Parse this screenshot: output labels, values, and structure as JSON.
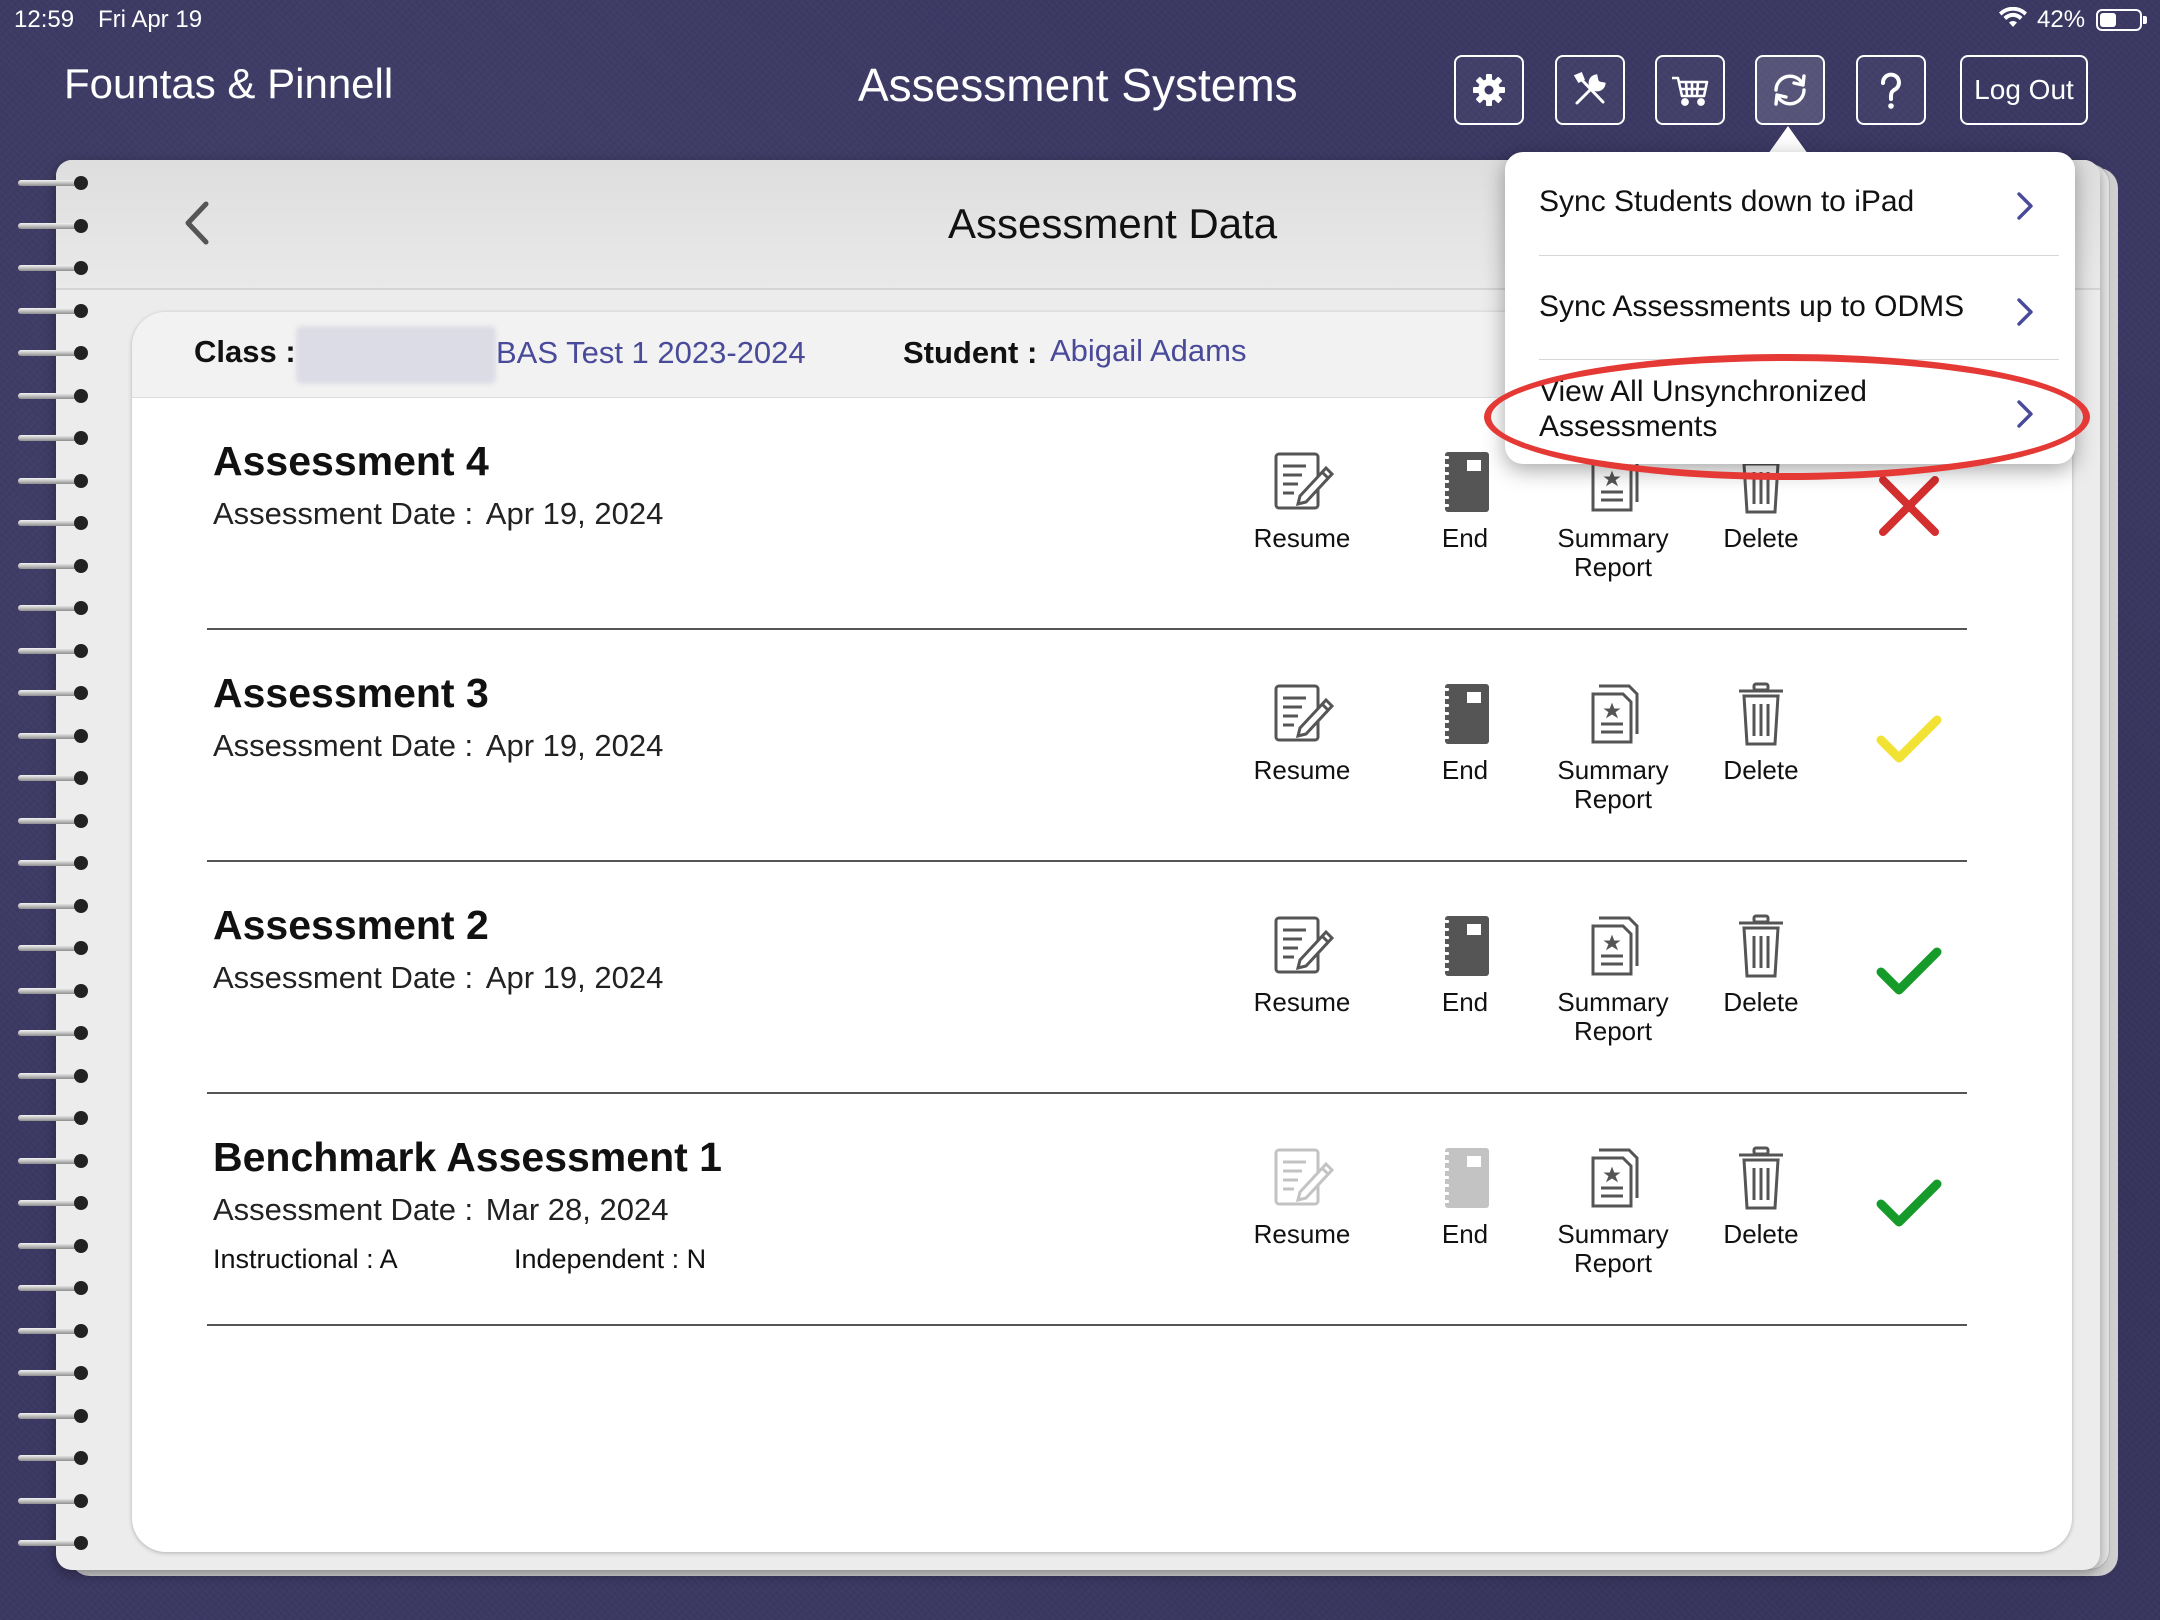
{
  "status_bar": {
    "time": "12:59",
    "date": "Fri Apr 19",
    "battery": "42%"
  },
  "header": {
    "brand": "Fountas & Pinnell",
    "title": "Assessment Systems",
    "buttons": [
      "gear-icon",
      "tools-icon",
      "cart-icon",
      "sync-icon",
      "help-icon"
    ],
    "logout": "Log Out"
  },
  "page": {
    "title": "Assessment Data"
  },
  "info": {
    "class_label": "Class :",
    "class_value": "BAS Test 1 2023-2024",
    "student_label": "Student :",
    "student_value": "Abigail Adams"
  },
  "assessments": [
    {
      "title": "Assessment 4",
      "date_label": "Assessment Date :",
      "date": "Apr 19, 2024",
      "status": "not-synced",
      "actions": [
        "Resume",
        "End",
        "Summary Report",
        "Delete"
      ]
    },
    {
      "title": "Assessment 3",
      "date_label": "Assessment Date :",
      "date": "Apr 19, 2024",
      "status": "pending",
      "actions": [
        "Resume",
        "End",
        "Summary Report",
        "Delete"
      ]
    },
    {
      "title": "Assessment 2",
      "date_label": "Assessment Date :",
      "date": "Apr 19, 2024",
      "status": "synced",
      "actions": [
        "Resume",
        "End",
        "Summary Report",
        "Delete"
      ]
    },
    {
      "title": "Benchmark Assessment 1",
      "date_label": "Assessment Date :",
      "date": "Mar 28, 2024",
      "instructional": "Instructional : A",
      "independent": "Independent : N",
      "status": "synced",
      "actions": [
        "Resume",
        "End",
        "Summary Report",
        "Delete"
      ]
    }
  ],
  "action_labels": {
    "resume": "Resume",
    "end": "End",
    "summary_1": "Summary",
    "summary_2": "Report",
    "delete": "Delete"
  },
  "sync_menu": {
    "items": [
      {
        "label": "Sync Students down to iPad"
      },
      {
        "label": "Sync Assessments up to ODMS"
      },
      {
        "label_1": "View All Unsynchronized",
        "label_2": "Assessments"
      }
    ]
  },
  "colors": {
    "accent": "#4a4a9a",
    "x_red": "#d32f2f",
    "pending_yellow": "#f2e233",
    "check_green": "#169a2a",
    "highlight": "#e53935"
  }
}
